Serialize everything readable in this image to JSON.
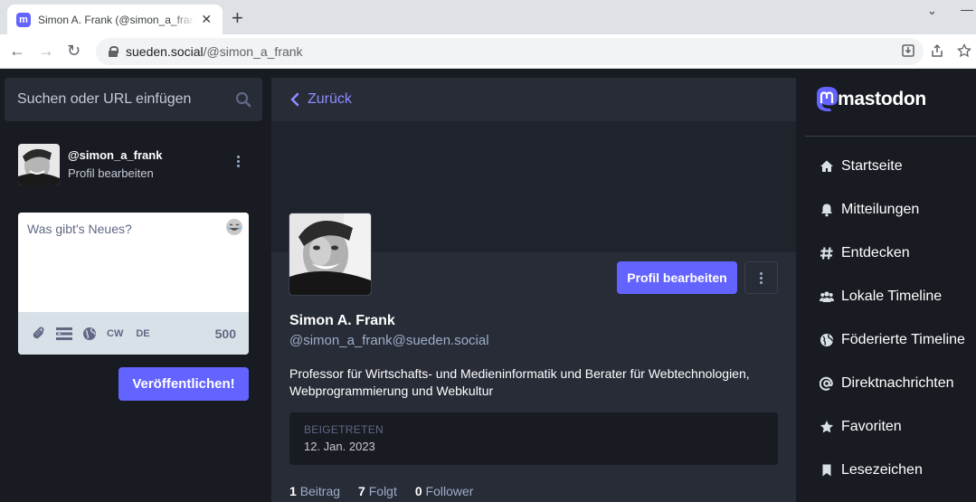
{
  "browser": {
    "tab_title": "Simon A. Frank (@simon_a_frank@sueden.social)",
    "tab_favicon": "m",
    "url_host": "sueden.social",
    "url_path": "/@simon_a_frank"
  },
  "search": {
    "placeholder": "Suchen oder URL einfügen"
  },
  "self": {
    "handle": "@simon_a_frank",
    "edit_link": "Profil bearbeiten"
  },
  "composer": {
    "placeholder": "Was gibt's Neues?",
    "cw_label": "CW",
    "lang_label": "DE",
    "char_count": "500",
    "publish_label": "Veröffentlichen!"
  },
  "column": {
    "back_label": "Zurück"
  },
  "profile": {
    "display_name": "Simon A. Frank",
    "handle": "@simon_a_frank@sueden.social",
    "edit_button": "Profil bearbeiten",
    "bio": "Professor für Wirtschafts- und Medieninformatik und Berater für Webtechnologien, Webprogrammierung und Webkultur",
    "joined_label": "BEIGETRETEN",
    "joined_date": "12. Jan. 2023",
    "stats": [
      {
        "count": "1",
        "label": "Beitrag"
      },
      {
        "count": "7",
        "label": "Folgt"
      },
      {
        "count": "0",
        "label": "Follower"
      }
    ]
  },
  "brand": {
    "logo_text": "mastodon",
    "accent": "#6364ff"
  },
  "nav": {
    "items": [
      {
        "icon": "home-icon",
        "label": "Startseite"
      },
      {
        "icon": "bell-icon",
        "label": "Mitteilungen"
      },
      {
        "icon": "hashtag-icon",
        "label": "Entdecken"
      },
      {
        "icon": "users-icon",
        "label": "Lokale Timeline"
      },
      {
        "icon": "globe-icon",
        "label": "Föderierte Timeline"
      },
      {
        "icon": "at-icon",
        "label": "Direktnachrichten"
      },
      {
        "icon": "star-icon",
        "label": "Favoriten"
      },
      {
        "icon": "bookmark-icon",
        "label": "Lesezeichen"
      }
    ]
  }
}
